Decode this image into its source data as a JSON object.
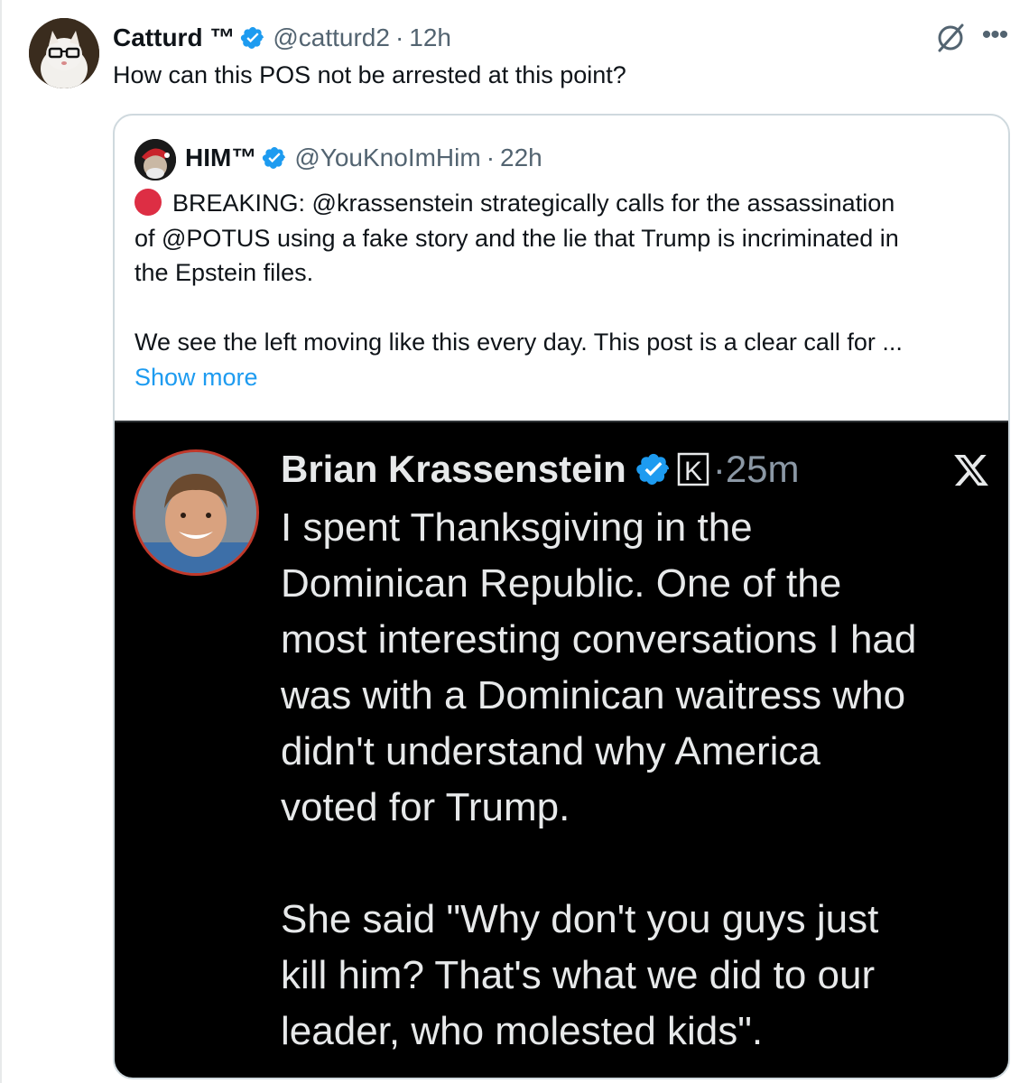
{
  "tweet": {
    "author_name": "Catturd ™",
    "handle": "@catturd2",
    "separator": "·",
    "time": "12h",
    "text": "How can this POS not be arrested at this point?",
    "icons": {
      "grok": "grok-icon",
      "more": "more-options-icon",
      "more_glyph": "•••"
    }
  },
  "quote": {
    "author_name": "HIM™",
    "handle": "@YouKnoImHim",
    "separator": "·",
    "time": "22h",
    "lines": [
      "BREAKING: @krassenstein strategically calls for the assassination",
      "of @POTUS using a fake story and the lie that Trump is incriminated in",
      "the Epstein files."
    ],
    "line4": "We see the left moving like this every day. This post is a clear call for ...",
    "show_more": "Show more",
    "embedded": {
      "author_name": "Brian Krassenstein",
      "separator": "·",
      "time": "25m",
      "k_badge": "K",
      "platform_icon": "x-logo-icon",
      "paragraph1": [
        "I spent Thanksgiving in the",
        "Dominican Republic.  One of the",
        "most interesting conversations I had",
        "was with a Dominican waitress who",
        "didn't understand why America",
        "voted for Trump."
      ],
      "paragraph2": [
        "She said \"Why don't you guys just",
        "kill him?  That's what we did to our",
        "leader, who molested kids\"."
      ]
    }
  },
  "colors": {
    "verified_blue": "#1d9bf0",
    "link_blue": "#1d9bf0",
    "breaking_dot": "#dd2e44",
    "secondary_text": "#536471"
  }
}
